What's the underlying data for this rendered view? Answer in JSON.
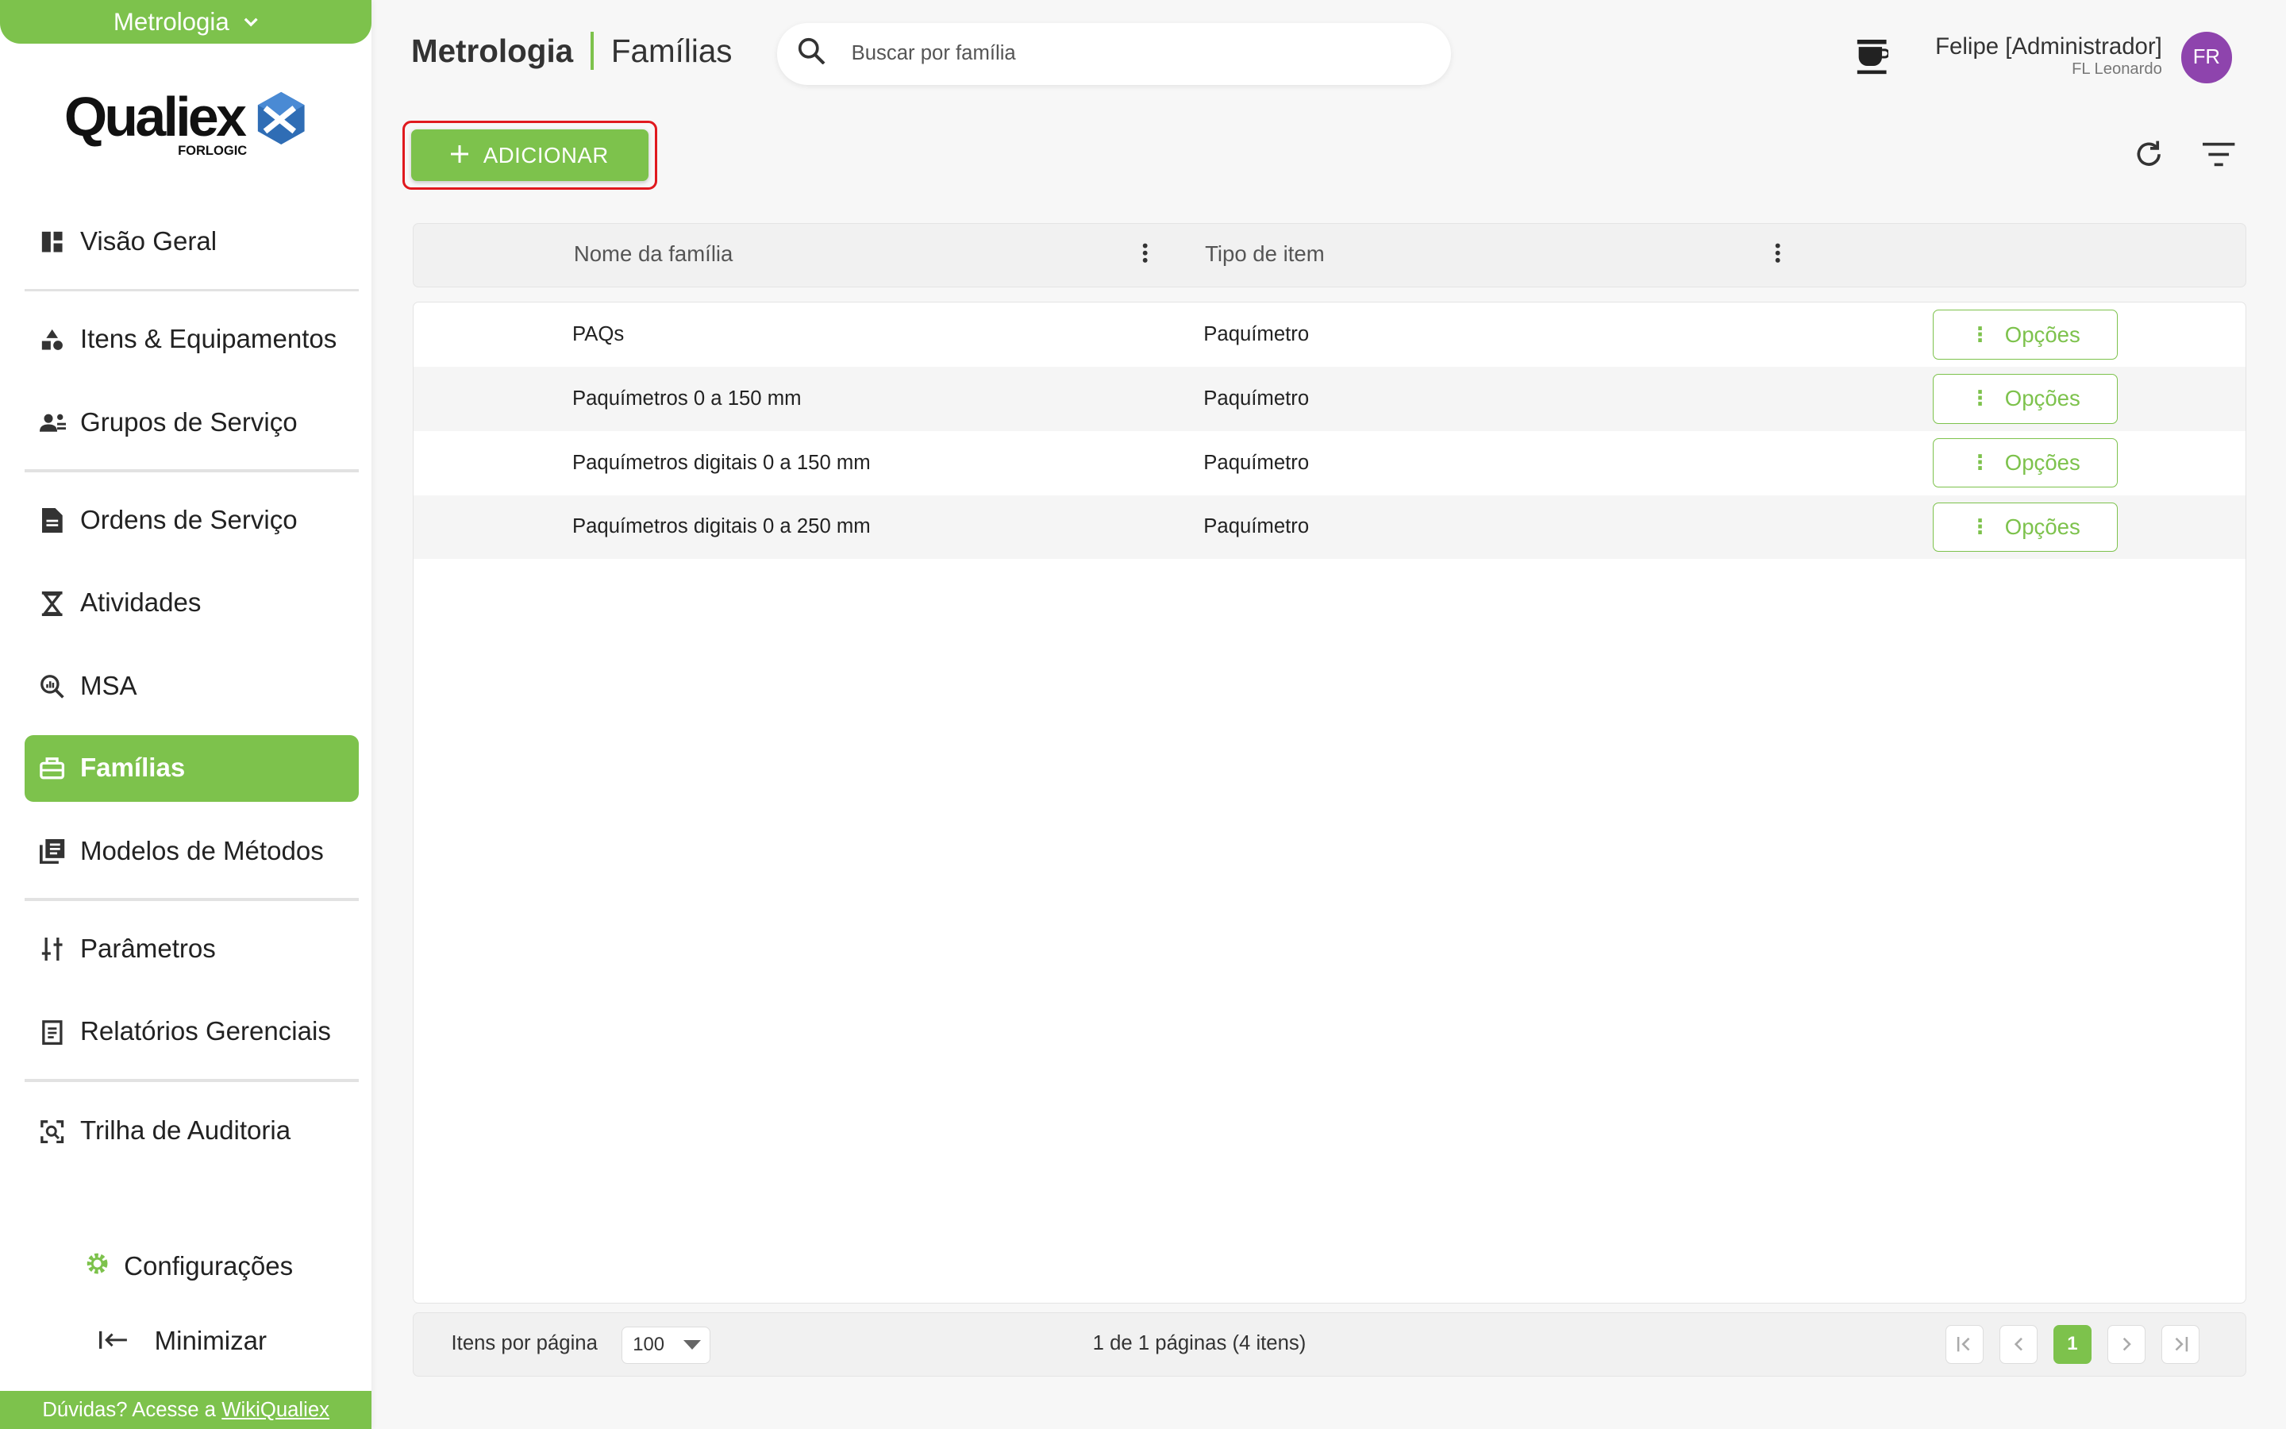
{
  "sidebar": {
    "module": "Metrologia",
    "logo_text": "Qualiex",
    "logo_sub": "FORLOGIC",
    "items": [
      {
        "label": "Visão Geral",
        "icon": "dashboard-icon"
      },
      {
        "label": "Itens & Equipamentos",
        "icon": "shapes-icon"
      },
      {
        "label": "Grupos de Serviço",
        "icon": "group-icon"
      },
      {
        "label": "Ordens de Serviço",
        "icon": "document-icon"
      },
      {
        "label": "Atividades",
        "icon": "hourglass-icon"
      },
      {
        "label": "MSA",
        "icon": "search-analysis-icon"
      },
      {
        "label": "Famílias",
        "icon": "toolbox-icon"
      },
      {
        "label": "Modelos de Métodos",
        "icon": "library-icon"
      },
      {
        "label": "Parâmetros",
        "icon": "sliders-icon"
      },
      {
        "label": "Relatórios Gerenciais",
        "icon": "report-icon"
      },
      {
        "label": "Trilha de Auditoria",
        "icon": "audit-icon"
      }
    ],
    "active_item": "Famílias",
    "settings_label": "Configurações",
    "minimize_label": "Minimizar",
    "help_text": "Dúvidas? Acesse a",
    "help_link": "WikiQualiex"
  },
  "header": {
    "module_title": "Metrologia",
    "page_title": "Famílias",
    "search_placeholder": "Buscar por família",
    "user_name": "Felipe [Administrador]",
    "user_org": "FL Leonardo",
    "avatar_initials": "FR"
  },
  "toolbar": {
    "add_label": "ADICIONAR"
  },
  "table": {
    "columns": [
      "Nome da família",
      "Tipo de item"
    ],
    "option_label": "Opções",
    "rows": [
      {
        "name": "PAQs",
        "type": "Paquímetro"
      },
      {
        "name": "Paquímetros 0 a 150 mm",
        "type": "Paquímetro"
      },
      {
        "name": "Paquímetros digitais 0 a 150 mm",
        "type": "Paquímetro"
      },
      {
        "name": "Paquímetros digitais 0 a 250 mm",
        "type": "Paquímetro"
      }
    ]
  },
  "footer": {
    "items_per_page_label": "Itens por página",
    "items_per_page": "100",
    "page_info": "1 de 1 páginas (4 itens)",
    "current_page": "1"
  },
  "colors": {
    "accent": "#7dc24c",
    "highlight_border": "#e0191e",
    "avatar": "#8e44ad"
  }
}
